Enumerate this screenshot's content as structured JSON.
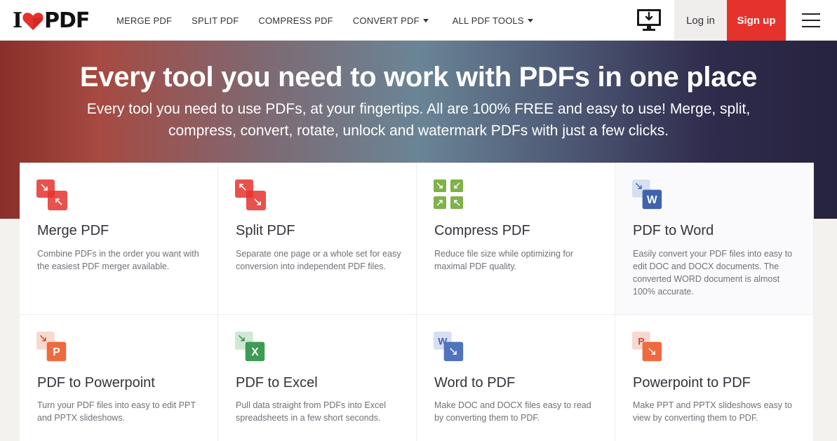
{
  "header": {
    "logo_i": "I",
    "logo_pdf": "PDF",
    "nav": [
      {
        "label": "MERGE PDF",
        "dropdown": false
      },
      {
        "label": "SPLIT PDF",
        "dropdown": false
      },
      {
        "label": "COMPRESS PDF",
        "dropdown": false
      },
      {
        "label": "CONVERT PDF",
        "dropdown": true
      },
      {
        "label": "ALL PDF TOOLS",
        "dropdown": true
      }
    ],
    "login_label": "Log in",
    "signup_label": "Sign up",
    "icons": [
      "desktop-download-icon",
      "hamburger-menu-icon"
    ],
    "colors": {
      "brand_red": "#e5322d",
      "login_bg": "#efeeec"
    }
  },
  "hero": {
    "title": "Every tool you need to work with PDFs in one place",
    "subtitle": "Every tool you need to use PDFs, at your fingertips. All are 100% FREE and easy to use! Merge, split, compress, convert, rotate, unlock and watermark PDFs with just a few clicks."
  },
  "tools": [
    {
      "title": "Merge PDF",
      "desc": "Combine PDFs in the order you want with the easiest PDF merger available.",
      "icon": "merge-pdf-icon"
    },
    {
      "title": "Split PDF",
      "desc": "Separate one page or a whole set for easy conversion into independent PDF files.",
      "icon": "split-pdf-icon"
    },
    {
      "title": "Compress PDF",
      "desc": "Reduce file size while optimizing for maximal PDF quality.",
      "icon": "compress-pdf-icon"
    },
    {
      "title": "PDF to Word",
      "desc": "Easily convert your PDF files into easy to edit DOC and DOCX documents. The converted WORD document is almost 100% accurate.",
      "icon": "pdf-to-word-icon",
      "badge": "W"
    },
    {
      "title": "PDF to Powerpoint",
      "desc": "Turn your PDF files into easy to edit PPT and PPTX slideshows.",
      "icon": "pdf-to-powerpoint-icon",
      "badge": "P"
    },
    {
      "title": "PDF to Excel",
      "desc": "Pull data straight from PDFs into Excel spreadsheets in a few short seconds.",
      "icon": "pdf-to-excel-icon",
      "badge": "X"
    },
    {
      "title": "Word to PDF",
      "desc": "Make DOC and DOCX files easy to read by converting them to PDF.",
      "icon": "word-to-pdf-icon",
      "badge": "W"
    },
    {
      "title": "Powerpoint to PDF",
      "desc": "Make PPT and PPTX slideshows easy to view by converting them to PDF.",
      "icon": "powerpoint-to-pdf-icon",
      "badge": "P"
    }
  ]
}
